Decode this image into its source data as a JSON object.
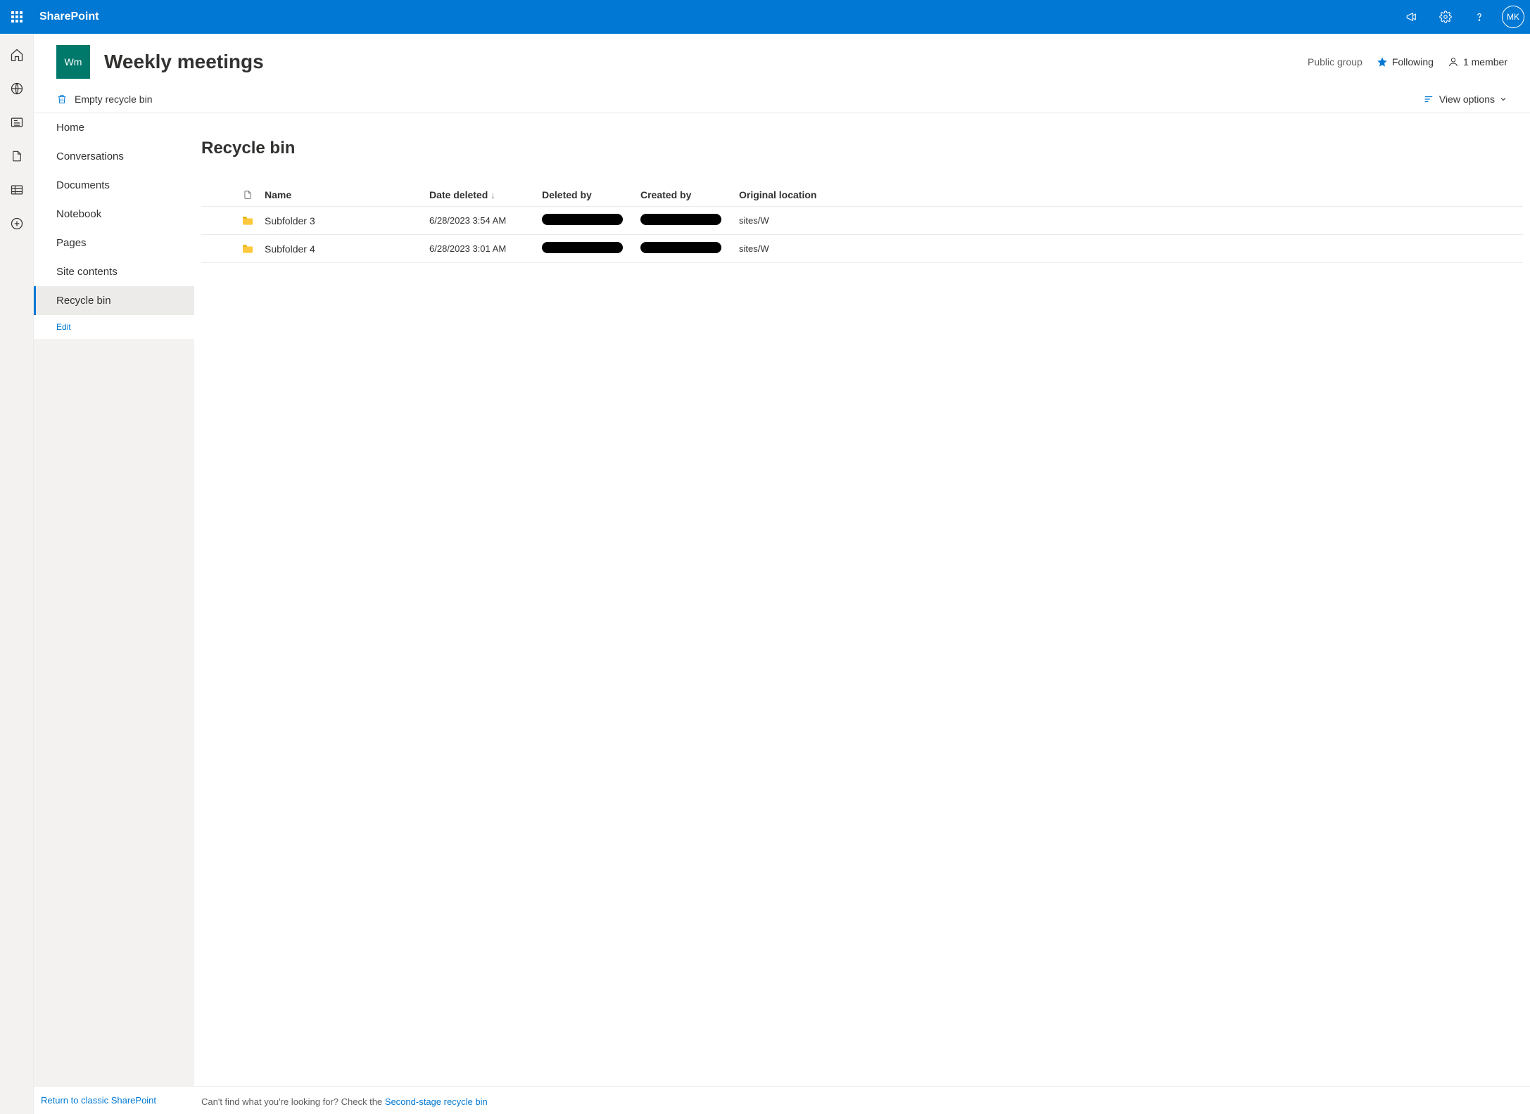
{
  "topbar": {
    "app_name": "SharePoint",
    "avatar_initials": "MK"
  },
  "site": {
    "logo_text": "Wm",
    "title": "Weekly meetings",
    "group_type": "Public group",
    "following_label": "Following",
    "members_label": "1 member"
  },
  "commandbar": {
    "empty_label": "Empty recycle bin",
    "view_options_label": "View options"
  },
  "leftnav": {
    "items": [
      {
        "label": "Home"
      },
      {
        "label": "Conversations"
      },
      {
        "label": "Documents"
      },
      {
        "label": "Notebook"
      },
      {
        "label": "Pages"
      },
      {
        "label": "Site contents"
      },
      {
        "label": "Recycle bin"
      }
    ],
    "edit_label": "Edit",
    "return_label": "Return to classic SharePoint"
  },
  "page": {
    "title": "Recycle bin",
    "columns": {
      "name": "Name",
      "date_deleted": "Date deleted",
      "deleted_by": "Deleted by",
      "created_by": "Created by",
      "original_location": "Original location"
    },
    "rows": [
      {
        "name": "Subfolder 3",
        "date_deleted": "6/28/2023 3:54 AM",
        "original_location": "sites/W"
      },
      {
        "name": "Subfolder 4",
        "date_deleted": "6/28/2023 3:01 AM",
        "original_location": "sites/W"
      }
    ],
    "footer_text": "Can't find what you're looking for? Check the ",
    "footer_link": "Second-stage recycle bin"
  }
}
